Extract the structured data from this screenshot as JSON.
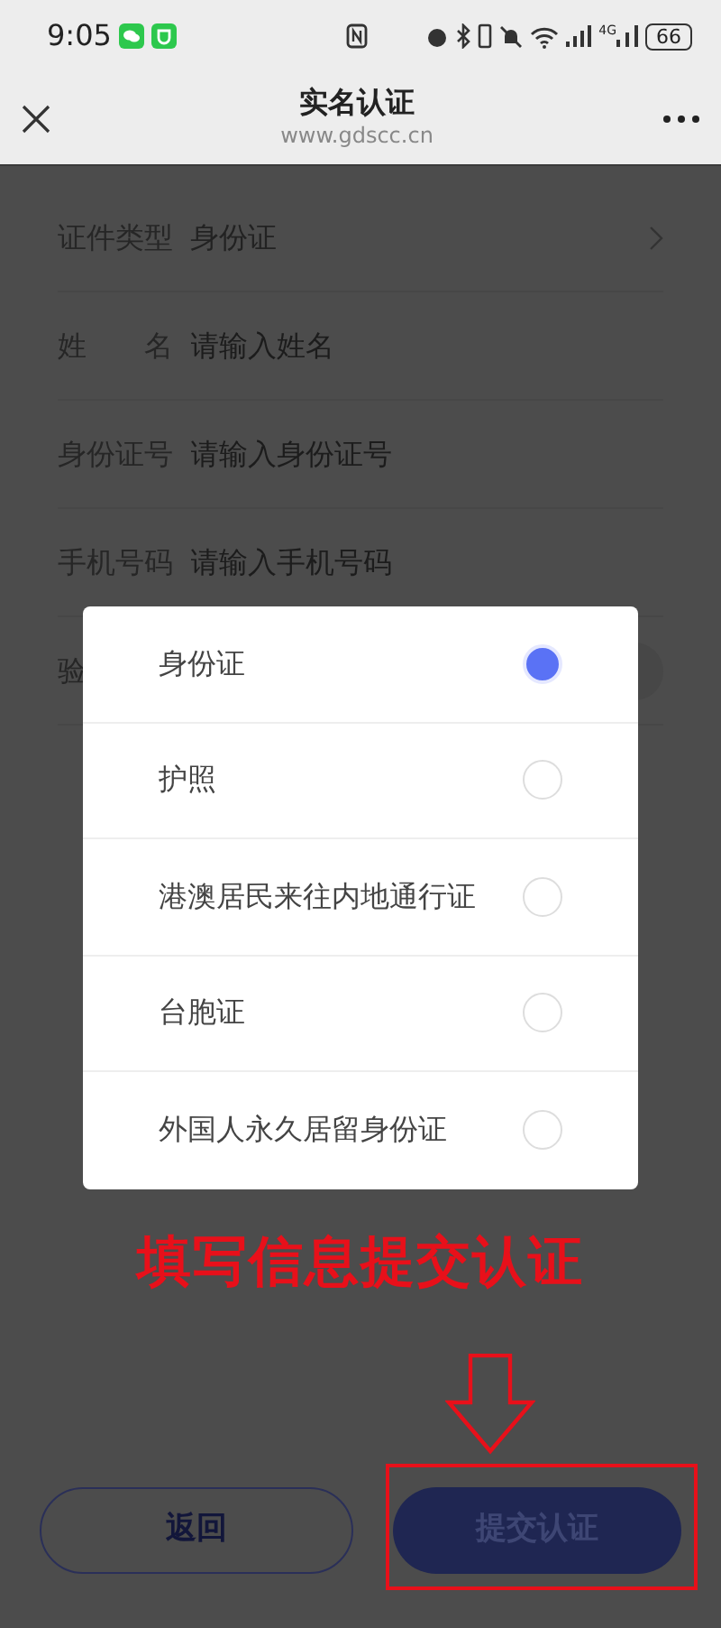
{
  "status_bar": {
    "time": "9:05",
    "network": "4G",
    "battery": "66"
  },
  "header": {
    "title": "实名认证",
    "url": "www.gdscc.cn"
  },
  "form": {
    "fields": [
      {
        "kind": "select",
        "label": "证件类型",
        "value": "身份证"
      },
      {
        "kind": "input",
        "label": "姓 名",
        "placeholder": "请输入姓名"
      },
      {
        "kind": "input",
        "label": "身份证号",
        "placeholder": "请输入身份证号"
      },
      {
        "kind": "input",
        "label": "手机号码",
        "placeholder": "请输入手机号码"
      },
      {
        "kind": "code",
        "label": "验"
      }
    ]
  },
  "picker": {
    "options": [
      {
        "label": "身份证",
        "selected": true
      },
      {
        "label": "护照",
        "selected": false
      },
      {
        "label": "港澳居民来往内地通行证",
        "selected": false
      },
      {
        "label": "台胞证",
        "selected": false
      },
      {
        "label": "外国人永久居留身份证",
        "selected": false
      }
    ]
  },
  "annotation": {
    "text": "填写信息提交认证"
  },
  "buttons": [
    {
      "kind": "outline",
      "label": "返回",
      "highlighted": false
    },
    {
      "kind": "primary",
      "label": "提交认证",
      "highlighted": true
    }
  ]
}
